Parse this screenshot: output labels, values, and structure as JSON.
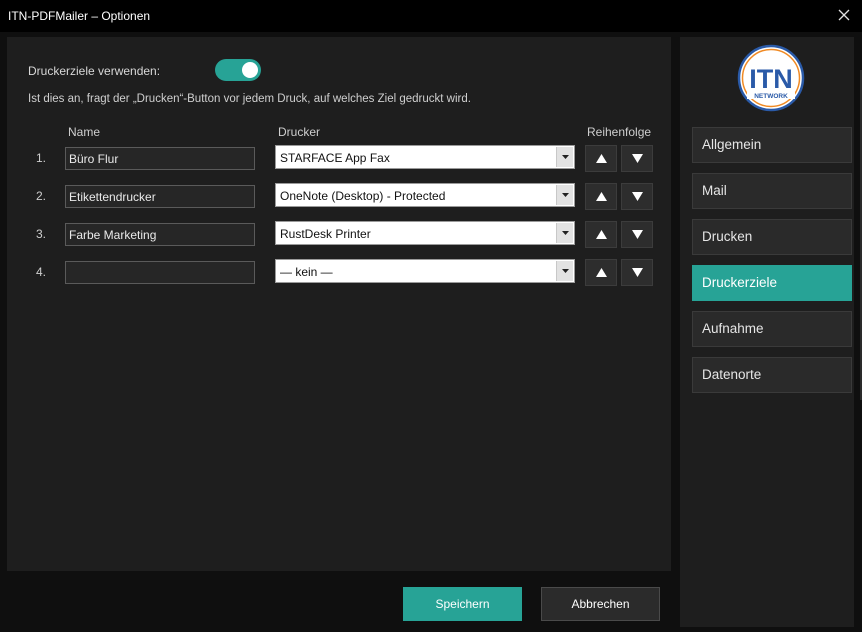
{
  "window": {
    "title": "ITN-PDFMailer – Optionen"
  },
  "settings": {
    "toggle_label": "Druckerziele verwenden:",
    "toggle_on": true,
    "hint": "Ist dies an, fragt der „Drucken“-Button vor jedem Druck, auf welches Ziel gedruckt wird."
  },
  "columns": {
    "name": "Name",
    "printer": "Drucker",
    "order": "Reihenfolge"
  },
  "rows": [
    {
      "num": "1.",
      "name": "Büro Flur",
      "printer": "STARFACE App Fax"
    },
    {
      "num": "2.",
      "name": "Etikettendrucker",
      "printer": "OneNote (Desktop) - Protected"
    },
    {
      "num": "3.",
      "name": "Farbe Marketing",
      "printer": "RustDesk Printer"
    },
    {
      "num": "4.",
      "name": "",
      "printer": "— kein —"
    }
  ],
  "logo": {
    "letters": "ITN",
    "subtitle": "NETWORK"
  },
  "nav": [
    {
      "label": "Allgemein",
      "active": false
    },
    {
      "label": "Mail",
      "active": false
    },
    {
      "label": "Drucken",
      "active": false
    },
    {
      "label": "Druckerziele",
      "active": true
    },
    {
      "label": "Aufnahme",
      "active": false
    },
    {
      "label": "Datenorte",
      "active": false
    }
  ],
  "buttons": {
    "save": "Speichern",
    "cancel": "Abbrechen"
  },
  "icons": {
    "close": "close-icon",
    "up": "arrow-up-icon",
    "down": "arrow-down-icon",
    "dropdown": "dropdown-arrow-icon"
  },
  "colors": {
    "accent": "#27a396",
    "background": "#1e1e1e",
    "titlebar": "#000000"
  }
}
